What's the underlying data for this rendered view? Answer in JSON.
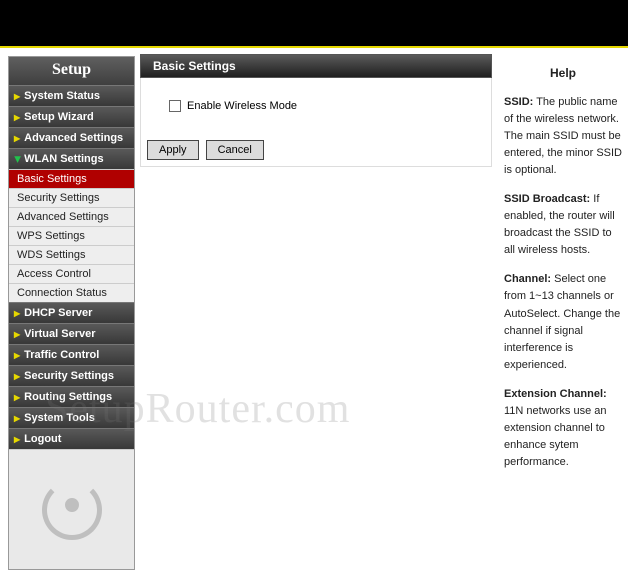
{
  "sidebar": {
    "title": "Setup",
    "sections": [
      {
        "label": "System Status",
        "expanded": false
      },
      {
        "label": "Setup Wizard",
        "expanded": false
      },
      {
        "label": "Advanced Settings",
        "expanded": false
      },
      {
        "label": "WLAN Settings",
        "expanded": true
      },
      {
        "label": "DHCP Server",
        "expanded": false
      },
      {
        "label": "Virtual Server",
        "expanded": false
      },
      {
        "label": "Traffic Control",
        "expanded": false
      },
      {
        "label": "Security Settings",
        "expanded": false
      },
      {
        "label": "Routing Settings",
        "expanded": false
      },
      {
        "label": "System Tools",
        "expanded": false
      },
      {
        "label": "Logout",
        "expanded": false
      }
    ],
    "wlan_subs": [
      {
        "label": "Basic Settings",
        "active": true
      },
      {
        "label": "Security Settings",
        "active": false
      },
      {
        "label": "Advanced Settings",
        "active": false
      },
      {
        "label": "WPS Settings",
        "active": false
      },
      {
        "label": "WDS Settings",
        "active": false
      },
      {
        "label": "Access Control",
        "active": false
      },
      {
        "label": "Connection Status",
        "active": false
      }
    ]
  },
  "main": {
    "panel_title": "Basic Settings",
    "enable_label": "Enable Wireless Mode",
    "apply_label": "Apply",
    "cancel_label": "Cancel"
  },
  "help": {
    "title": "Help",
    "p1_bold": "SSID:",
    "p1_text": " The public name of the wireless network. The main SSID must be entered, the minor SSID is optional.",
    "p2_bold": "SSID Broadcast:",
    "p2_text": " If enabled, the router will broadcast the SSID to all wireless hosts.",
    "p3_bold": "Channel:",
    "p3_text": " Select one from 1~13 channels or AutoSelect. Change the channel if signal interference is experienced.",
    "p4_bold": "Extension Channel:",
    "p4_text": " 11N networks use an extension channel to enhance sytem performance."
  },
  "watermark": "SetupRouter.com"
}
